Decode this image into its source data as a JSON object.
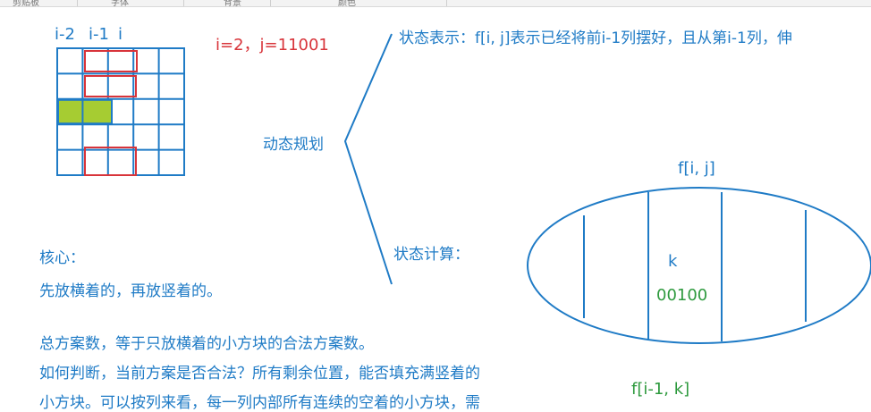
{
  "topbar": {
    "tabs": [
      "剪贴板",
      "字体",
      "背景",
      "颜色"
    ]
  },
  "grid": {
    "col_labels": [
      "i-2",
      "i-1",
      "i"
    ],
    "rows": 5,
    "cols": 5
  },
  "example_state": "i=2，j=11001",
  "dp_label": "动态规划",
  "state_repr": "状态表示：f[i, j]表示已经将前i-1列摆好，且从第i-1列，伸",
  "state_calc": "状态计算：",
  "ellipse": {
    "top_label": "f[i, j]",
    "k_label": "k",
    "k_value": "00100",
    "bottom_label": "f[i-1, k]"
  },
  "core": {
    "title": "核心：",
    "line1": "先放横着的，再放竖着的。"
  },
  "paragraph": {
    "line1": "总方案数，等于只放横着的小方块的合法方案数。",
    "line2": "如何判断，当前方案是否合法？所有剩余位置，能否填充满竖着的",
    "line3": "小方块。可以按列来看，每一列内部所有连续的空着的小方块，需"
  },
  "colors": {
    "blue": "#1f7bc6",
    "red": "#d8343a",
    "green_fill": "#a6cc32",
    "green_text": "#2e9a3e"
  }
}
